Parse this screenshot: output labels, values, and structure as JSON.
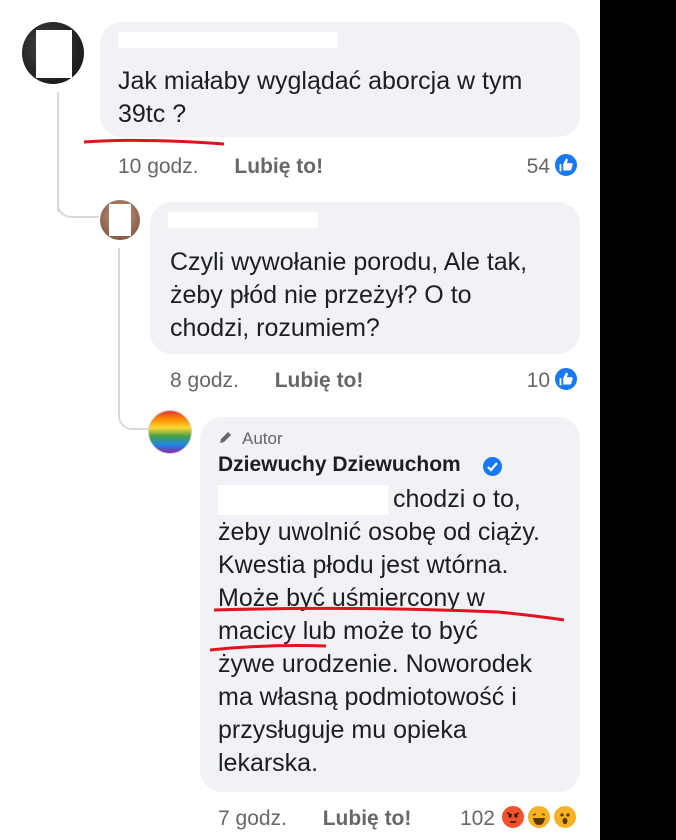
{
  "comments": [
    {
      "text": "Jak miałaby wyglądać aborcja w tym\n39tc ?",
      "time": "10 godz.",
      "like_label": "Lubię to!",
      "reaction_count": "54",
      "reactions": [
        "like-icon"
      ]
    },
    {
      "text": "Czyli wywołanie porodu, Ale tak,\nżeby płód nie przeżył? O to\nchodzi, rozumiem?",
      "time": "8 godz.",
      "like_label": "Lubię to!",
      "reaction_count": "10",
      "reactions": [
        "like-icon"
      ]
    },
    {
      "author_label": "Autor",
      "author_name": "Dziewuchy Dziewuchom",
      "verified": true,
      "text_first": "chodzi o to,",
      "text": "żeby uwolnić osobę od ciąży.\nKwestia płodu jest wtórna.\nMoże być uśmiercony w\nmacicy lub może to być\nżywe urodzenie. Noworodek\nma własną podmiotowość i\nprzysługuje mu opieka\nlekarska.",
      "time": "7 godz.",
      "like_label": "Lubię to!",
      "reaction_count": "102",
      "reactions": [
        "angry-icon",
        "laugh-icon",
        "wow-icon"
      ]
    }
  ],
  "colors": {
    "bubble": "#f0f2f5",
    "meta_text": "#65676b",
    "like_blue": "#1877f2",
    "annotation_red": "#e0141e"
  }
}
